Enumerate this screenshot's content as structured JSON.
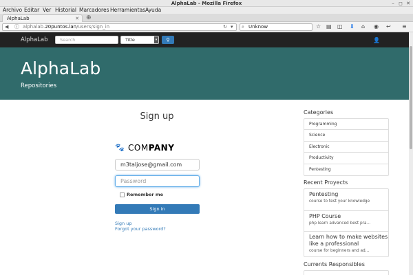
{
  "window": {
    "title": "AlphaLab - Mozilla Firefox"
  },
  "menubar": {
    "items": [
      "Archivo",
      "Editar",
      "Ver",
      "Historial",
      "Marcadores",
      "Herramientas",
      "Ayuda"
    ]
  },
  "tab": {
    "label": "AlphaLab"
  },
  "urlbar": {
    "prefix": "alphalab.",
    "host": "20puntos.lan",
    "path": "/users/sign_in"
  },
  "searchbar": {
    "value": "Unknow"
  },
  "sitenav": {
    "brand": "AlphaLab",
    "search_placeholder": "Search",
    "select_value": "Title"
  },
  "hero": {
    "title": "AlphaLab",
    "subtitle": "Repositories"
  },
  "signup": {
    "title": "Sign up",
    "logo_text_light": "COM",
    "logo_text_bold": "PANY",
    "email_value": "m3taljose@gmail.com",
    "password_placeholder": "Password",
    "remember_label": "Remember me",
    "signin_label": "Sign in",
    "signup_link": "Sign up",
    "forgot_link": "Forgot your password?"
  },
  "sidebar": {
    "categories_title": "Categories",
    "categories": [
      "Programming",
      "Science",
      "Electronic",
      "Productivity",
      "Pentesting"
    ],
    "projects_title": "Recent Proyects",
    "projects": [
      {
        "title": "Pentesting",
        "desc": "course to test your knowledge"
      },
      {
        "title": "PHP Course",
        "desc": "php learn advanced best pra..."
      },
      {
        "title": "Learn how to make websites like a professional",
        "desc": "course for beginners and ad..."
      }
    ],
    "responsibles_title": "Currents Responsibles"
  }
}
